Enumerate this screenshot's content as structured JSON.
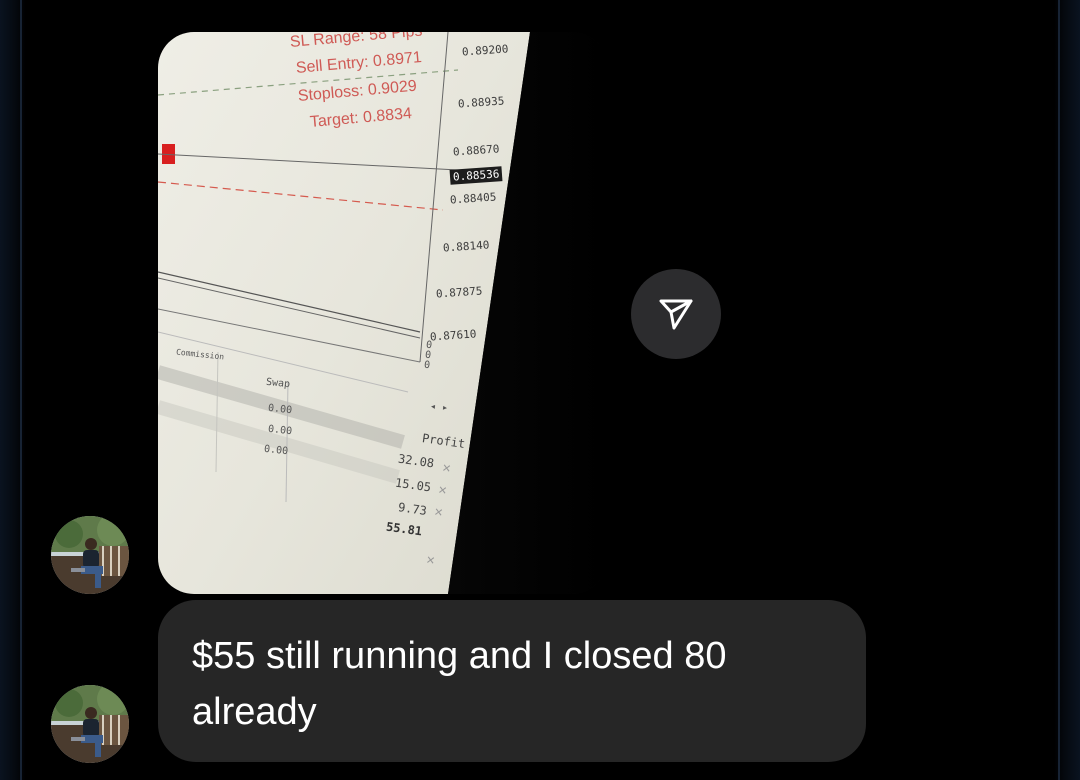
{
  "photo": {
    "trade_info": {
      "sl_range": "SL Range: 58 Pips",
      "sell_entry": "Sell Entry: 0.8971",
      "stoploss": "Stoploss: 0.9029",
      "target": "Target: 0.8834"
    },
    "price_axis": [
      "0.89200",
      "0.88935",
      "0.88670",
      "0.88536",
      "0.88405",
      "0.88140",
      "0.87875",
      "0.87610"
    ],
    "axis_zeros": [
      "0",
      "0",
      "0"
    ],
    "table": {
      "commission_header": "Commission",
      "swap_header": "Swap",
      "swap_values": [
        "0.00",
        "0.00",
        "0.00"
      ],
      "profit_header": "Profit",
      "profit_values": [
        "32.08",
        "15.05",
        "9.73"
      ],
      "profit_total": "55.81",
      "nav_arrows": "◂ ▸"
    }
  },
  "message": {
    "text": "$55 still running and I closed 80 already"
  }
}
